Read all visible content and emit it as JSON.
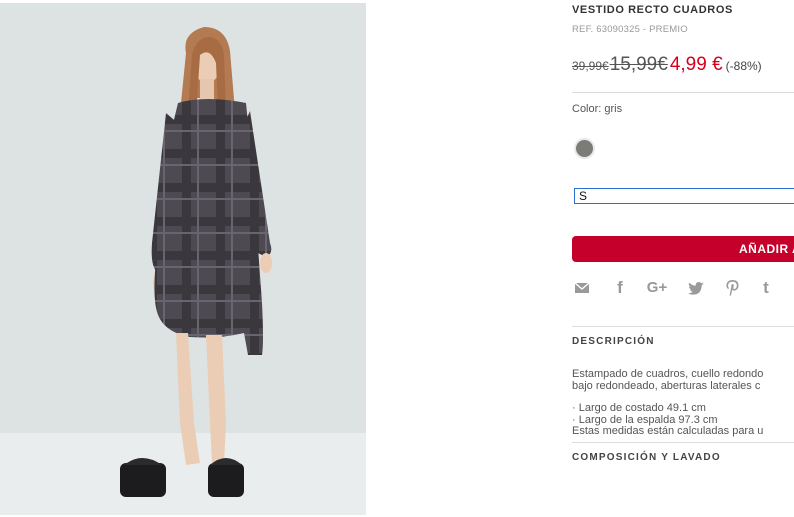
{
  "product": {
    "title": "VESTIDO RECTO CUADROS",
    "ref": "REF. 63090325 - PREMIO",
    "price_old": "39,99€",
    "price_mid": "15,99€",
    "price_now": "4,99 €",
    "discount": "(-88%)",
    "color_label": "Color: gris",
    "swatch_color": "#7b7b78",
    "size_selected": "S",
    "add_button_label": "AÑADIR A"
  },
  "share_icons": [
    "email-icon",
    "facebook-icon",
    "google-plus-icon",
    "twitter-icon",
    "pinterest-icon",
    "tumblr-icon"
  ],
  "description": {
    "title": "DESCRIPCIÓN",
    "line1": "Estampado de cuadros, cuello redondo",
    "line2": "bajo redondeado, aberturas laterales c",
    "measure1": "· Largo de costado 49.1 cm",
    "measure2": "· Largo de la espalda 97.3 cm",
    "measure_note": "Estas medidas están calculadas para u"
  },
  "composition": {
    "title": "COMPOSICIÓN Y LAVADO"
  },
  "colors": {
    "accent_red": "#d6001c",
    "button_red": "#c4002b",
    "photo_bg": "#dde3e3"
  }
}
